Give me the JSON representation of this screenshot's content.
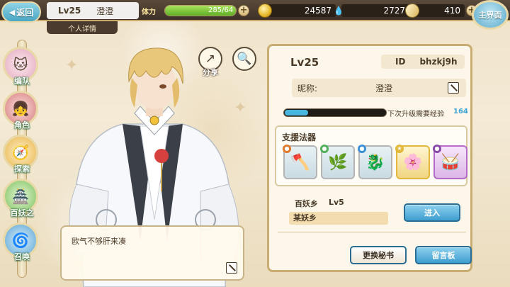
{
  "topbar": {
    "back_label": "返回",
    "player_level": "Lv25",
    "player_name": "澄澄",
    "detail_tab": "个人详情",
    "stamina_label": "体力",
    "stamina_value": "285/64",
    "stamina_fill": 1.0,
    "coins": "24587",
    "drops": "2727",
    "cards": "410",
    "main_label": "主界面"
  },
  "sidebar": {
    "items": [
      {
        "label": "编队",
        "icon": "team-icon"
      },
      {
        "label": "角色",
        "icon": "character-icon"
      },
      {
        "label": "探索",
        "icon": "explore-icon"
      },
      {
        "label": "百妖之",
        "icon": "demon-icon"
      },
      {
        "label": "召唤",
        "icon": "summon-icon"
      }
    ]
  },
  "actions": {
    "share_label": "分享"
  },
  "speech": {
    "text": "欧气不够肝来凑"
  },
  "panel": {
    "level": "Lv25",
    "id_label": "ID",
    "id_value": "bhzkj9h",
    "nickname_label": "昵称:",
    "nickname_value": "澄澄",
    "exp_label": "下次升级需要经验",
    "exp_value": "164",
    "exp_fill": 0.23,
    "support_title": "支援法器",
    "support_items": [
      {
        "icon": "axe-icon",
        "color": "#9fd3e8"
      },
      {
        "icon": "vine-icon",
        "color": "#bfe6cf"
      },
      {
        "icon": "dragon-icon",
        "color": "#bcd9f2"
      },
      {
        "icon": "wreath-icon",
        "color": "#f3dc8c"
      },
      {
        "icon": "drum-icon",
        "color": "#e8c9ee"
      }
    ],
    "village_name": "百妖乡",
    "village_level": "Lv5",
    "village_sub": "某妖乡",
    "enter_label": "进入",
    "change_secretary_label": "更换秘书",
    "message_board_label": "留言板"
  }
}
